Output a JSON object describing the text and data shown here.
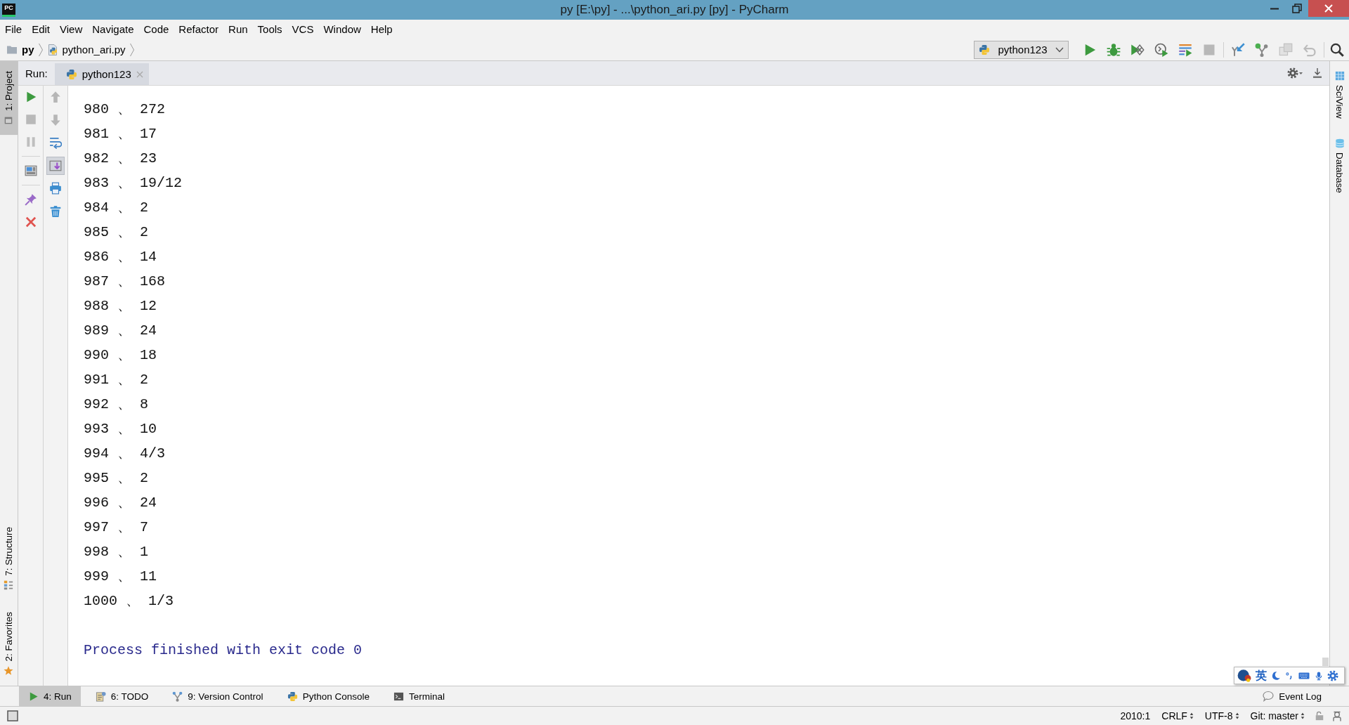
{
  "window": {
    "logo": "PC",
    "title": "py [E:\\py] - ...\\python_ari.py [py] - PyCharm"
  },
  "menu": [
    "File",
    "Edit",
    "View",
    "Navigate",
    "Code",
    "Refactor",
    "Run",
    "Tools",
    "VCS",
    "Window",
    "Help"
  ],
  "navigation": {
    "breadcrumbs": [
      {
        "kind": "folder",
        "label": "py"
      },
      {
        "kind": "file",
        "label": "python_ari.py"
      }
    ],
    "run_config": "python123",
    "toolbar": [
      [
        {
          "kind": "run",
          "disabled": false
        },
        {
          "kind": "debug",
          "disabled": false
        },
        {
          "kind": "coverage",
          "disabled": false
        },
        {
          "kind": "profile",
          "disabled": false
        },
        {
          "kind": "concurrency",
          "disabled": false
        },
        {
          "kind": "stop",
          "disabled": true
        }
      ],
      [
        {
          "kind": "update",
          "disabled": false
        },
        {
          "kind": "commit",
          "disabled": false
        },
        {
          "kind": "compare",
          "disabled": true
        },
        {
          "kind": "revert",
          "disabled": true
        }
      ],
      [
        {
          "kind": "search",
          "disabled": false
        }
      ]
    ]
  },
  "tool_stripes": {
    "left_top": [
      {
        "kind": "project",
        "label": "1: Project",
        "selected": true
      }
    ],
    "left_bottom": [
      {
        "kind": "structure",
        "label": "7: Structure",
        "selected": false
      },
      {
        "kind": "favorites",
        "label": "2: Favorites",
        "selected": false
      }
    ],
    "right": [
      {
        "kind": "sciview",
        "label": "SciView",
        "selected": false
      },
      {
        "kind": "database",
        "label": "Database",
        "selected": false
      }
    ]
  },
  "run_panel": {
    "title": "Run:",
    "tabs": [
      {
        "label": "python123",
        "selected": true
      }
    ],
    "toolbar_left": [
      [
        {
          "kind": "rerun",
          "disabled": false
        },
        {
          "kind": "stop",
          "disabled": true
        },
        {
          "kind": "pause",
          "disabled": true
        }
      ],
      [
        {
          "kind": "layout",
          "disabled": false
        }
      ],
      [
        {
          "kind": "pin",
          "disabled": false
        },
        {
          "kind": "close",
          "disabled": false
        }
      ]
    ],
    "toolbar_right": [
      {
        "kind": "up",
        "disabled": true,
        "on": false
      },
      {
        "kind": "down",
        "disabled": true,
        "on": false
      },
      {
        "kind": "wrap",
        "disabled": false,
        "on": false
      },
      {
        "kind": "scroll_end",
        "disabled": false,
        "on": true
      },
      {
        "kind": "print",
        "disabled": false,
        "on": false
      },
      {
        "kind": "clear",
        "disabled": false,
        "on": false
      }
    ]
  },
  "console": {
    "lines": [
      "980 、 272",
      "981 、 17",
      "982 、 23",
      "983 、 19/12",
      "984 、 2",
      "985 、 2",
      "986 、 14",
      "987 、 168",
      "988 、 12",
      "989 、 24",
      "990 、 18",
      "991 、 2",
      "992 、 8",
      "993 、 10",
      "994 、 4/3",
      "995 、 2",
      "996 、 24",
      "997 、 7",
      "998 、 1",
      "999 、 11",
      "1000 、 1/3"
    ],
    "exit_message": "Process finished with exit code 0"
  },
  "ime_toolbar": {
    "mode": "英"
  },
  "bottom_bar": {
    "tabs": [
      {
        "kind": "run",
        "label": "4: Run",
        "selected": true
      },
      {
        "kind": "todo",
        "label": "6: TODO",
        "selected": false
      },
      {
        "kind": "vcs",
        "label": "9: Version Control",
        "selected": false
      },
      {
        "kind": "console",
        "label": "Python Console",
        "selected": false
      },
      {
        "kind": "terminal",
        "label": "Terminal",
        "selected": false
      }
    ],
    "event_log": "Event Log"
  },
  "status_bar": {
    "position": "2010:1",
    "line_separator": "CRLF",
    "encoding": "UTF-8",
    "branch": "Git: master"
  }
}
